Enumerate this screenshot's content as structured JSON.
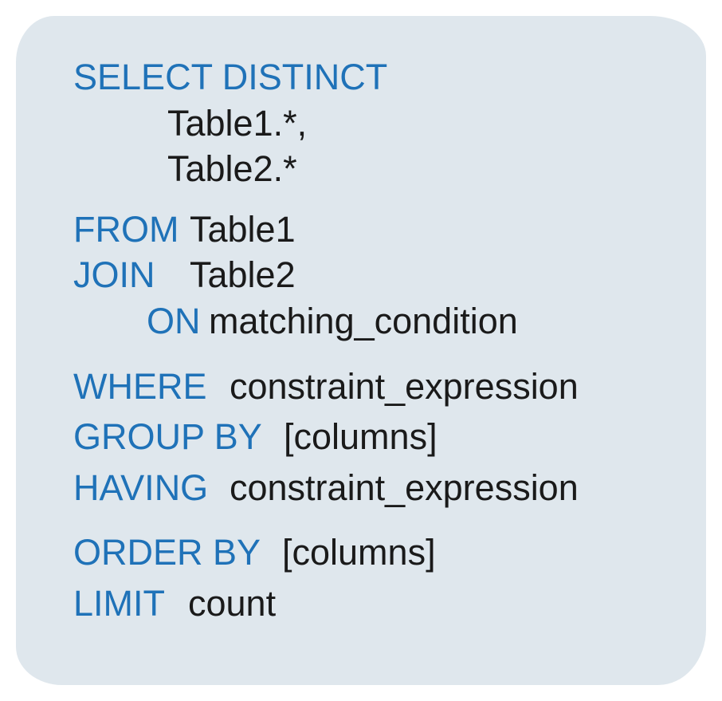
{
  "sql": {
    "select": {
      "keyword": "SELECT DISTINCT",
      "cols": {
        "c1": "Table1.*,",
        "c2": "Table2.*"
      }
    },
    "from": {
      "keyword": "FROM",
      "value": "Table1"
    },
    "join": {
      "keyword": "JOIN",
      "value": "Table2"
    },
    "on": {
      "keyword": "ON",
      "value": "matching_condition"
    },
    "where": {
      "keyword": "WHERE",
      "value": "constraint_expression"
    },
    "groupby": {
      "keyword": "GROUP BY",
      "value": "[columns]"
    },
    "having": {
      "keyword": "HAVING",
      "value": "constraint_expression"
    },
    "orderby": {
      "keyword": "ORDER BY",
      "value": "[columns]"
    },
    "limit": {
      "keyword": "LIMIT",
      "value": "count"
    }
  }
}
